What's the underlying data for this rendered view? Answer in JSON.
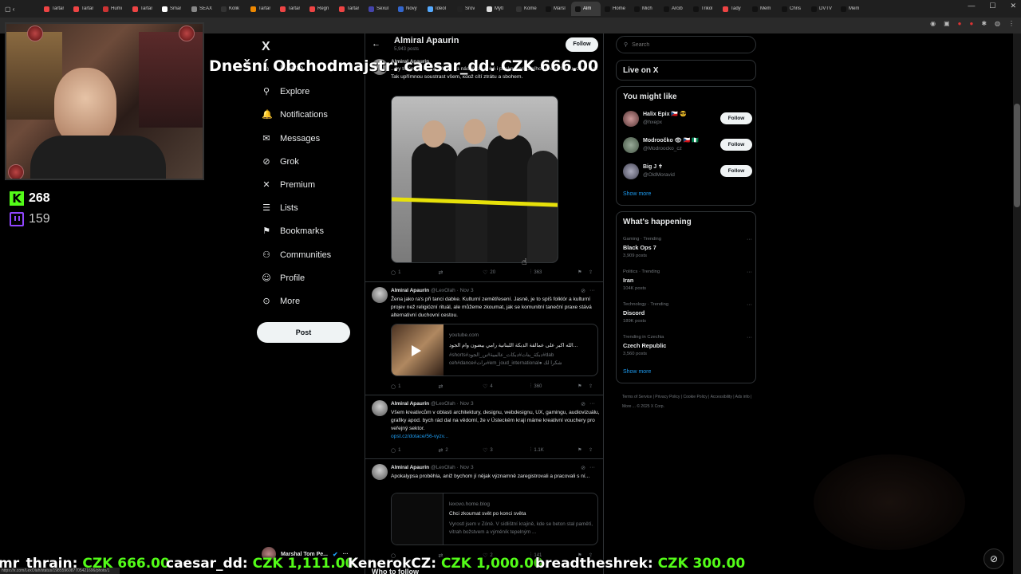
{
  "browser": {
    "tabs": [
      "Tartar",
      "Tartar",
      "Humi",
      "Tartar",
      "Smar",
      "SEAX",
      "Kolik",
      "Tartar",
      "Tartar",
      "Regn",
      "Tartar",
      "Sexul",
      "Nový",
      "Ideol",
      "Srov",
      "Mýtl",
      "Kome",
      "Marsl",
      "Alm",
      "Home",
      "Mich",
      "Arcib",
      "Trikol",
      "Tady",
      "Mem",
      "Chris",
      "DVTV",
      "Mem"
    ],
    "active_tab_index": 18,
    "window_buttons": [
      "—",
      "☐",
      "✕"
    ],
    "status_url": "https://x.com/LexOlah/status/1985596087705421696/photo/1"
  },
  "overlay": {
    "kick_count": "268",
    "twitch_count": "159",
    "donation_top": "Dnešní Obchodmajstr: caesar_dd: CZK 666.00",
    "ticker": [
      {
        "name": "mr_thrain:",
        "amount": "CZK 666.00"
      },
      {
        "name": "caesar_dd:",
        "amount": "CZK 1,111.00"
      },
      {
        "name": "KenerokCZ:",
        "amount": "CZK 1,000.00"
      },
      {
        "name": "breadtheshrek:",
        "amount": "CZK 300.00"
      }
    ]
  },
  "nav": {
    "logo": "X",
    "items": [
      {
        "label": "Home",
        "icon": "home-icon",
        "glyph": "⌂"
      },
      {
        "label": "Explore",
        "icon": "search-icon",
        "glyph": "⚲"
      },
      {
        "label": "Notifications",
        "icon": "bell-icon",
        "glyph": "🔔"
      },
      {
        "label": "Messages",
        "icon": "mail-icon",
        "glyph": "✉"
      },
      {
        "label": "Grok",
        "icon": "grok-icon",
        "glyph": "⊘"
      },
      {
        "label": "Premium",
        "icon": "x-icon",
        "glyph": "✕"
      },
      {
        "label": "Lists",
        "icon": "list-icon",
        "glyph": "☰"
      },
      {
        "label": "Bookmarks",
        "icon": "bookmark-icon",
        "glyph": "⚑"
      },
      {
        "label": "Communities",
        "icon": "people-icon",
        "glyph": "⚇"
      },
      {
        "label": "Profile",
        "icon": "person-icon",
        "glyph": "☺"
      },
      {
        "label": "More",
        "icon": "more-icon",
        "glyph": "⊙"
      }
    ],
    "post_label": "Post",
    "account_name": "Marshal Tom Pe..."
  },
  "profile": {
    "name": "Almiral Apaurin",
    "posts": "5,943 posts",
    "follow_label": "Follow"
  },
  "tweets": [
    {
      "name": "Almiral Apaurin",
      "handle": "",
      "date": "",
      "text": "...by to čekal, co? A někde na nás třeba čeká i páska klerikálního paternalismu, co já vím. Tak upřímnou soustrast všem, kdož cítí ztrátu a sbohem.",
      "replies": "1",
      "reposts": "",
      "likes": "20",
      "views": "363"
    },
    {
      "name": "Almiral Apaurin",
      "handle": "@LexOlah",
      "date": "Nov 3",
      "text": "Žena jako ra's při tanci dabke. Kulturní zemětřesení. Jasně, je to spíš folklór a kulturní projev než religiózní rituál, ale můžeme zkoumat, jak se komunitní taneční praxe stává alternativní duchovní cestou.",
      "card_domain": "youtube.com",
      "card_title": "الله اكبر على عمالقة الدبكة اللبنانية رامي بيضون وام الجود...",
      "card_desc": "#shorts#دبكة_بنات#دبكات_عالمية#بن_الجود#dab ceh#dance#تراث#em_joud_international● شكرا لك",
      "replies": "1",
      "reposts": "",
      "likes": "4",
      "views": "360"
    },
    {
      "name": "Almiral Apaurin",
      "handle": "@LexOlah",
      "date": "Nov 3",
      "text": "Všem kreativcům v oblasti architektury, designu, webdesignu, UX, gamingu, audiovizuálu, grafiky apod. bych rád dal na vědomí, že v Ústeckém kraji máme kreativní vouchery pro veřejný sektor.",
      "link": "opst.cz/dotace/56-vyzv...",
      "replies": "1",
      "reposts": "2",
      "likes": "3",
      "views": "1.1K"
    },
    {
      "name": "Almiral Apaurin",
      "handle": "@LexOlah",
      "date": "Nov 3",
      "text": "Apokalypsa proběhla, aniž bychom jí nějak významně zaregistrovali a pracovali s ní...",
      "card_domain": "lexovo.home.blog",
      "card_title": "Chci zkoumat svět po konci světa",
      "card_desc": "Vyrostl jsem v Zóně. V sídlištní krajině, kde se beton stal pamětí, vítrah božstvem a výměník tepelným ...",
      "replies": "",
      "reposts": "",
      "likes": "2",
      "views": "141"
    }
  ],
  "right": {
    "search_placeholder": "Search",
    "live_title": "Live on X",
    "might_like_title": "You might like",
    "suggestions": [
      {
        "name": "Halix Epix 🇨🇿 😎",
        "handle": "@hxepx",
        "button": "Follow"
      },
      {
        "name": "Modroočko 👁 🇨🇿 🇳🇬",
        "handle": "@Modroocko_cz",
        "button": "Follow"
      },
      {
        "name": "Big J ✝",
        "handle": "@OldMoravid",
        "button": "Follow"
      }
    ],
    "show_more": "Show more",
    "happening_title": "What's happening",
    "trends": [
      {
        "category": "Gaming · Trending",
        "name": "Black Ops 7",
        "posts": "3,909 posts"
      },
      {
        "category": "Politics · Trending",
        "name": "Iran",
        "posts": "104K posts"
      },
      {
        "category": "Technology · Trending",
        "name": "Discord",
        "posts": "189K posts"
      },
      {
        "category": "Trending in Czechia",
        "name": "Czech Republic",
        "posts": "3,560 posts"
      }
    ],
    "show_more_2": "Show more",
    "footer": "Terms of Service  |  Privacy Policy  |  Cookie Policy  |  Accessibility  |  Ads info  |  More ...  © 2025 X Corp."
  },
  "who_to_follow": "Who to follow",
  "colors": {
    "accent": "#1d9bf0",
    "kick": "#53fc18",
    "twitch": "#9146ff"
  }
}
